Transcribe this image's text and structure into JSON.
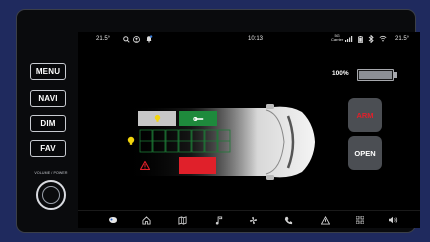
{
  "side_buttons": [
    "MENU",
    "NAVI",
    "DIM",
    "FAV"
  ],
  "knob_label": "VOLUME / POWER",
  "status": {
    "temp_left": "21.5°",
    "time": "10:13",
    "carrier": "Carrier",
    "signal_label": "5G",
    "temp_right": "21.5°"
  },
  "battery": {
    "text": "100%",
    "level": 1.0
  },
  "buttons": {
    "arm": "ARM",
    "open": "OPEN"
  },
  "colors": {
    "bezel": "#0a0b0d",
    "screen": "#000000",
    "slot_grey": "#c7c7c7",
    "slot_green": "#1e8a3c",
    "slot_red": "#e0202a",
    "arm_text": "#e0202a",
    "open_text": "#ffffff",
    "grid_green": "#1d7a36",
    "bulb_yellow": "#f2d40c",
    "warning_red": "#e0202a"
  },
  "icons": {
    "status": [
      "search-icon",
      "user-icon",
      "bell-icon",
      "signal-bars-icon",
      "battery-small-icon",
      "bluetooth-icon",
      "wifi-icon"
    ],
    "slots": [
      "bulb-icon",
      "wrench-icon",
      "bulb-icon",
      "warning-icon"
    ],
    "dock": [
      "home-icon",
      "home-icon",
      "map-icon",
      "music-icon",
      "fan-icon",
      "phone-icon",
      "warning-icon",
      "apps-icon",
      "volume-icon"
    ]
  }
}
